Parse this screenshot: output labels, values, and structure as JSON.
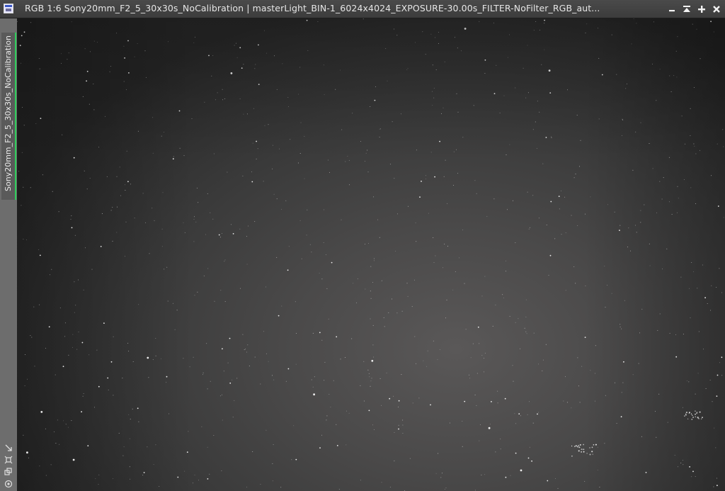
{
  "window": {
    "title": "RGB 1:6 Sony20mm_F2_5_30x30s_NoCalibration | masterLight_BIN-1_6024x4024_EXPOSURE-30.00s_FILTER-NoFilter_RGB_aut...",
    "icon": "image-window-icon",
    "controls": {
      "minimize": "minimize-icon",
      "shade": "shade-icon",
      "maximize": "maximize-icon",
      "close": "close-icon"
    }
  },
  "sidebar": {
    "view_tab_label": "Sony20mm_F2_5_30x30s_NoCalibration",
    "view_tab_accent": "#2ecc5a",
    "tools": [
      "drag-icon",
      "fit-icon",
      "clone-icon",
      "target-icon"
    ]
  },
  "canvas": {
    "content": "star-field-image"
  }
}
